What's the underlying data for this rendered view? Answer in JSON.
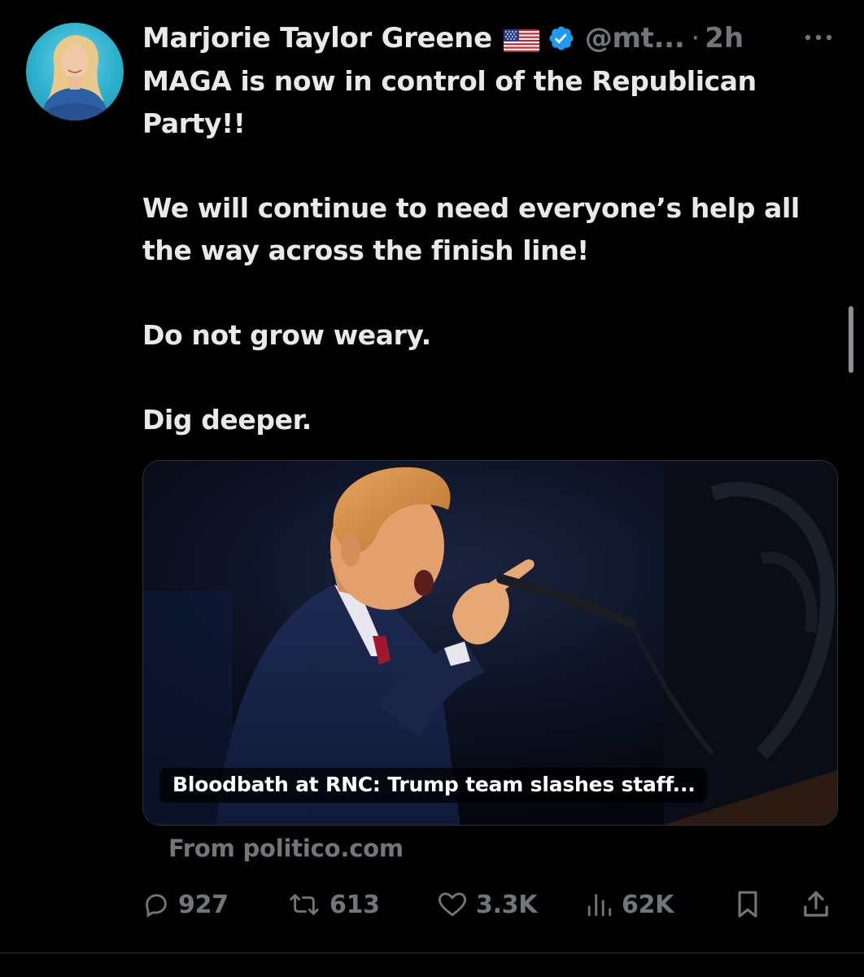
{
  "tweet": {
    "author": {
      "display_name": "Marjorie Taylor Greene",
      "flag_emoji": "🇺🇸",
      "verified": true,
      "handle": "@mt...",
      "separator": "·",
      "timestamp": "2h"
    },
    "text_paragraphs": [
      "MAGA is now in control of the Republican Party!!",
      "We will continue to need everyone’s help all the way across the finish line!",
      "Do not grow weary.",
      "Dig deeper."
    ],
    "card": {
      "headline": "Bloodbath at RNC: Trump team slashes staff...",
      "source": "From politico.com"
    },
    "actions": {
      "replies": "927",
      "reposts": "613",
      "likes": "3.3K",
      "views": "62K"
    }
  },
  "colors": {
    "background": "#000000",
    "text_primary": "#e7e9ea",
    "text_secondary": "#71767b",
    "verified_blue": "#1d9bf0",
    "border": "#2f3336"
  },
  "icons": {
    "more": "more-horizontal-icon",
    "verified": "verified-badge-icon",
    "flag": "us-flag-icon",
    "reply": "reply-icon",
    "repost": "repost-icon",
    "like": "heart-icon",
    "views": "views-icon",
    "bookmark": "bookmark-icon",
    "share": "share-icon"
  }
}
